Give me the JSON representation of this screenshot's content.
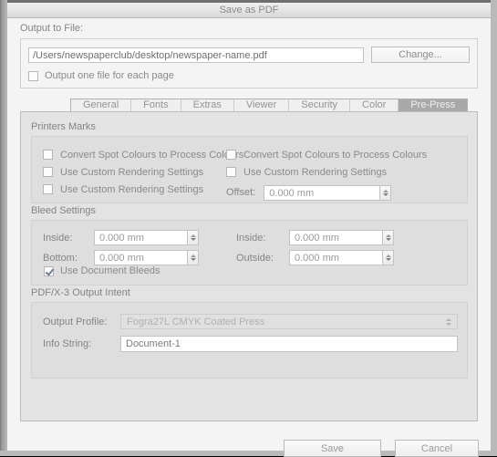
{
  "window": {
    "title": "Save as PDF"
  },
  "output": {
    "label": "Output to File:",
    "path_value": "/Users/newspaperclub/desktop/newspaper-name.pdf",
    "path_placeholder": "",
    "change_button": "Change...",
    "one_file_checkbox_label": "Output one file for each page",
    "one_file_checked": false
  },
  "tabs": [
    {
      "label": "General",
      "selected": false
    },
    {
      "label": "Fonts",
      "selected": false
    },
    {
      "label": "Extras",
      "selected": false
    },
    {
      "label": "Viewer",
      "selected": false
    },
    {
      "label": "Security",
      "selected": false
    },
    {
      "label": "Color",
      "selected": false
    },
    {
      "label": "Pre-Press",
      "selected": true
    }
  ],
  "printers_marks": {
    "title": "Printers Marks",
    "left_checks": [
      {
        "label": "Convert Spot Colours to Process Colours",
        "checked": false
      },
      {
        "label": "Use Custom Rendering Settings",
        "checked": false
      },
      {
        "label": "Use Custom Rendering Settings",
        "checked": false
      }
    ],
    "right_checks": [
      {
        "label": "Convert Spot Colours to Process Colours",
        "checked": false
      },
      {
        "label": "Use Custom Rendering Settings",
        "checked": false
      }
    ],
    "offset_label": "Offset:",
    "offset_value": "0.000 mm"
  },
  "bleed": {
    "title": "Bleed Settings",
    "left_fields": [
      {
        "label": "Inside:",
        "value": "0.000 mm"
      },
      {
        "label": "Bottom:",
        "value": "0.000 mm"
      }
    ],
    "right_fields": [
      {
        "label": "Inside:",
        "value": "0.000 mm"
      },
      {
        "label": "Outside:",
        "value": "0.000 mm"
      }
    ],
    "use_document_bleeds_label": "Use Document Bleeds",
    "use_document_bleeds_checked": true
  },
  "output_intent": {
    "title": "PDF/X-3 Output Intent",
    "profile_label": "Output Profile:",
    "profile_value": "Fogra27L CMYK Coated Press",
    "info_label": "Info String:",
    "info_value": "Document-1"
  },
  "footer": {
    "save_label": "Save",
    "cancel_label": "Cancel"
  },
  "colors": {
    "dialog_background": "#f4f4f4",
    "panel_background": "#e3e3e3",
    "group_background": "#dedede",
    "selected_tab": "#a9a9a9",
    "text": "#8a8a8a",
    "field_background": "#ffffff"
  }
}
